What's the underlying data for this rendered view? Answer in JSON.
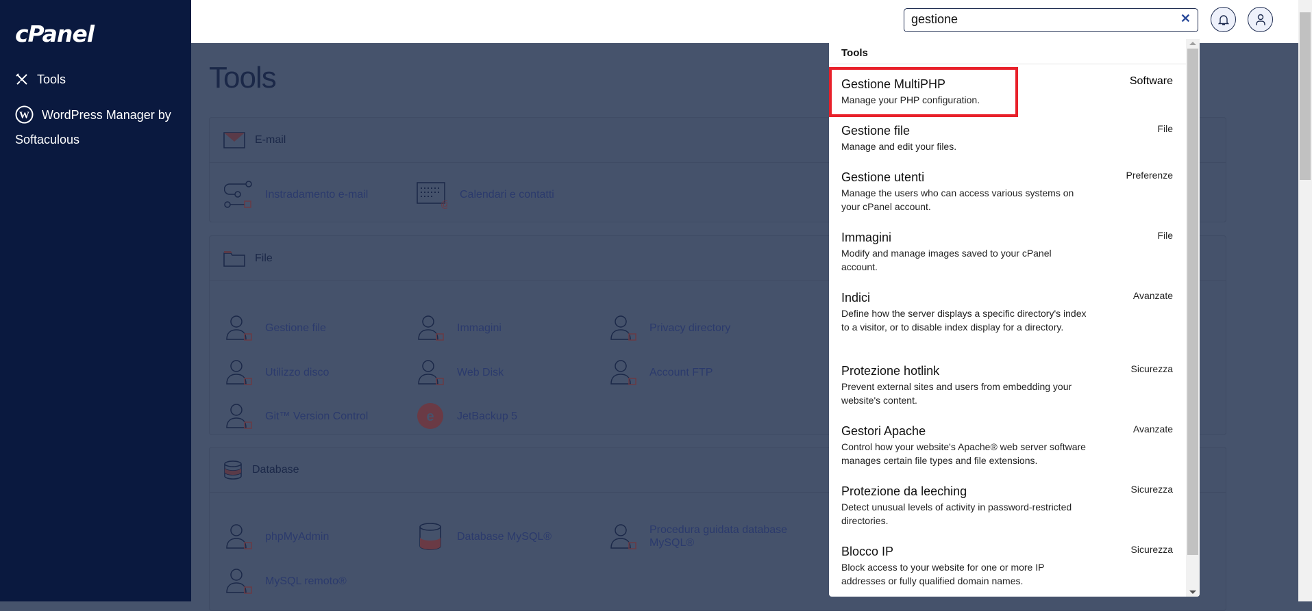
{
  "sidebar": {
    "logo": "cPanel",
    "items": [
      {
        "label": "Tools",
        "icon": "tools-icon"
      },
      {
        "label": "WordPress Manager by Softaculous",
        "icon": "wordpress-icon"
      }
    ]
  },
  "header": {
    "search_value": "gestione",
    "clear_icon": "close-icon",
    "notifications_icon": "bell-icon",
    "user_icon": "user-icon"
  },
  "main": {
    "title": "Tools",
    "sections": [
      {
        "title": "E-mail",
        "items": [
          "Instradamento e-mail",
          "Calendari e contatti"
        ]
      },
      {
        "title": "File",
        "items": [
          "Gestione file",
          "Immagini",
          "Privacy directory",
          "Utilizzo disco",
          "Web Disk",
          "Account FTP",
          "Git™ Version Control",
          "JetBackup 5"
        ]
      },
      {
        "title": "Database",
        "items": [
          "phpMyAdmin",
          "Database MySQL®",
          "Procedura guidata database MySQL®",
          "MySQL remoto®"
        ]
      }
    ]
  },
  "dropdown": {
    "heading": "Tools",
    "results": [
      {
        "title": "Gestione MultiPHP",
        "desc": "Manage your PHP configuration.",
        "category": "Software",
        "highlighted": true
      },
      {
        "title": "Gestione file",
        "desc": "Manage and edit your files.",
        "category": "File"
      },
      {
        "title": "Gestione utenti",
        "desc": "Manage the users who can access various systems on your cPanel account.",
        "category": "Preferenze"
      },
      {
        "title": "Immagini",
        "desc": "Modify and manage images saved to your cPanel account.",
        "category": "File"
      },
      {
        "title": "Indici",
        "desc": "Define how the server displays a specific directory's index to a visitor, or to disable index display for a directory.",
        "category": "Avanzate"
      },
      {
        "title": "Protezione hotlink",
        "desc": "Prevent external sites and users from embedding your website's content.",
        "category": "Sicurezza"
      },
      {
        "title": "Gestori Apache",
        "desc": "Control how your website's Apache® web server software manages certain file types and file extensions.",
        "category": "Avanzate"
      },
      {
        "title": "Protezione da leeching",
        "desc": "Detect unusual levels of activity in password-restricted directories.",
        "category": "Sicurezza"
      },
      {
        "title": "Blocco IP",
        "desc": "Block access to your website for one or more IP addresses or fully qualified domain names.",
        "category": "Sicurezza"
      }
    ]
  },
  "colors": {
    "sidebar": "#0a193f",
    "overlay": "#46536c",
    "highlight": "#e8202a"
  }
}
